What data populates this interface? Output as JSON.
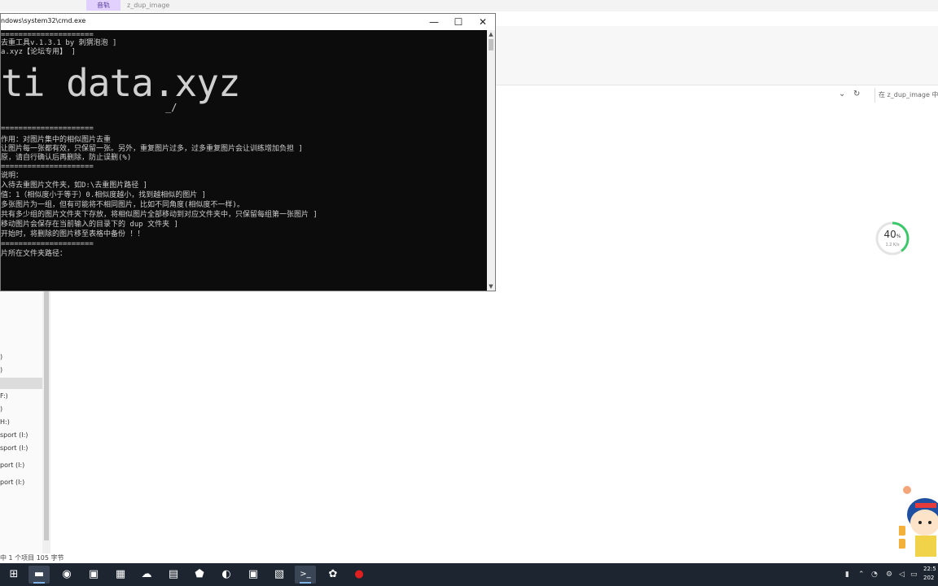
{
  "explorer": {
    "tabs": [
      "音轨",
      "z_dup_image"
    ],
    "search_placeholder": "在 z_dup_image 中",
    "nav_items": [
      {
        "label": ")",
        "selected": false
      },
      {
        "label": ")",
        "selected": false
      },
      {
        "label": "",
        "selected": true
      },
      {
        "label": "F:)",
        "selected": false
      },
      {
        "label": ")",
        "selected": false
      },
      {
        "label": "H:)",
        "selected": false
      },
      {
        "label": "sport (I:)",
        "selected": false
      },
      {
        "label": "sport (I:)",
        "selected": false
      },
      {
        "label": "port (I:)",
        "selected": false
      },
      {
        "label": "port (I:)",
        "selected": false
      }
    ],
    "status": "中 1 个项目  105 字节"
  },
  "gauge": {
    "value": 40,
    "unit": "%",
    "sub": "1.2 K/s",
    "fraction": 0.4,
    "color": "#3cc76b"
  },
  "cmd": {
    "title": "ndows\\system32\\cmd.exe",
    "controls": {
      "minimize": "—",
      "maximize": "☐",
      "close": "✕"
    },
    "lines": [
      "=====================",
      "去重工具v.1.3.1 by 刺猬泡泡 ]",
      "a.xyz【论坛专用】 ]",
      "=====================",
      "作用：对图片集中的相似图片去重",
      "让图片每一张都有效，只保留一张。另外，重复图片过多，过多重复图片会让训练增加负担 ]",
      "原，请自行确认后再删除，防止误删(%)",
      "=====================",
      "说明：",
      "入待去重图片文件夹，如D:\\去重图片路径 ]",
      "值：1（相似度小于等于）0.相似度越小，找到越相似的图片 ]",
      "多张图片为一组，但有可能将不相同图片，比如不同角度(相似度不一样)。",
      "共有多少组的图片文件夹下存放，将相似图片全部移动到对应文件夹中，只保留每组第一张图片 ]",
      "移动图片会保存在当前输入的目录下的 dup 文件夹 ]",
      "开始时，将删除的图片移至表格中备份 ！！",
      "=====================",
      "片所在文件夹路径："
    ],
    "ascii_art": "ti data.xyz"
  },
  "taskbar": {
    "items": [
      {
        "icon": "windows-start-icon",
        "glyph": "⊞"
      },
      {
        "icon": "file-explorer-icon",
        "glyph": "▬"
      },
      {
        "icon": "chrome-icon",
        "glyph": "◉"
      },
      {
        "icon": "app-icon",
        "glyph": "▣"
      },
      {
        "icon": "terminal-app-icon",
        "glyph": "▦"
      },
      {
        "icon": "cloud-app-icon",
        "glyph": "☁"
      },
      {
        "icon": "app-icon",
        "glyph": "▤"
      },
      {
        "icon": "app-icon",
        "glyph": "⬟"
      },
      {
        "icon": "app-icon",
        "glyph": "◐"
      },
      {
        "icon": "app-icon",
        "glyph": "▣"
      },
      {
        "icon": "notes-icon",
        "glyph": "▧"
      },
      {
        "icon": "cmd-icon",
        "glyph": ">_"
      },
      {
        "icon": "app-icon",
        "glyph": "✿"
      },
      {
        "icon": "record-icon",
        "glyph": "●"
      }
    ],
    "clock_time": "22:5",
    "clock_date": "202"
  }
}
